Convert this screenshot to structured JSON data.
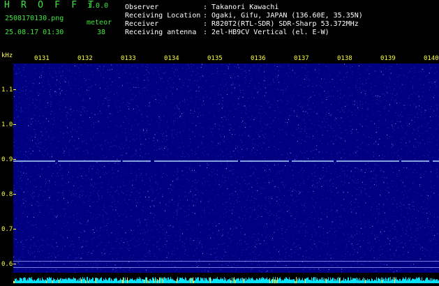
{
  "header": {
    "app_title": "H R O F F T",
    "version": "1.0.0",
    "filename": "2508170130.png",
    "datetime": "25.08.17 01:30",
    "meteor_label": "meteor",
    "meteor_count": "38"
  },
  "info": {
    "rows": [
      {
        "label": "Observer",
        "value": ": Takanori Kawachi"
      },
      {
        "label": "Receiving Location",
        "value": ": Ogaki, Gifu, JAPAN (136.60E, 35.35N)"
      },
      {
        "label": "Receiver",
        "value": ": R820T2(RTL-SDR) SDR-Sharp 53.372MHz"
      },
      {
        "label": "Receiving antenna",
        "value": ": 2el-HB9CV Vertical (el. E-W)"
      }
    ]
  },
  "chart_data": {
    "type": "heatmap",
    "ylabel": "kHz",
    "y_ticks": [
      "1.1",
      "1.0",
      "0.9",
      "0.8",
      "0.7",
      "0.6"
    ],
    "x_ticks": [
      "0131",
      "0132",
      "0133",
      "0134",
      "0135",
      "0136",
      "0137",
      "0138",
      "0139",
      "0140"
    ],
    "carrier_khz": 0.895,
    "ylim": [
      0.575,
      1.175
    ],
    "colors": {
      "background": "#000080",
      "noise": "#2030c8",
      "carrier": "#b0d8ff",
      "label": "#ffff40",
      "header_green": "#3ee63e",
      "strip": "#00e5ff"
    }
  }
}
